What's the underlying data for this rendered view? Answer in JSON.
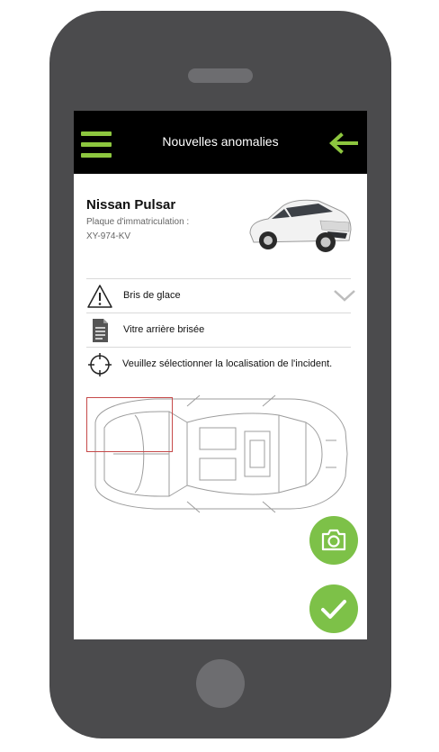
{
  "header": {
    "title": "Nouvelles anomalies",
    "menu_icon": "hamburger-icon",
    "back_icon": "arrow-left-icon"
  },
  "vehicle": {
    "name": "Nissan Pulsar",
    "plate_label": "Plaque d'immatriculation :",
    "plate_value": "XY-974-KV"
  },
  "form": {
    "damage_type": "Bris de glace",
    "description": "Vitre arrière brisée",
    "location_hint": "Veuillez sélectionner la localisation de l'incident."
  },
  "actions": {
    "camera_icon": "camera-icon",
    "confirm_icon": "check-icon"
  },
  "colors": {
    "accent": "#8dc63f",
    "fab": "#7dc148",
    "topbar": "#000000",
    "phone_body": "#4b4b4d",
    "selection": "#c64a4a"
  }
}
